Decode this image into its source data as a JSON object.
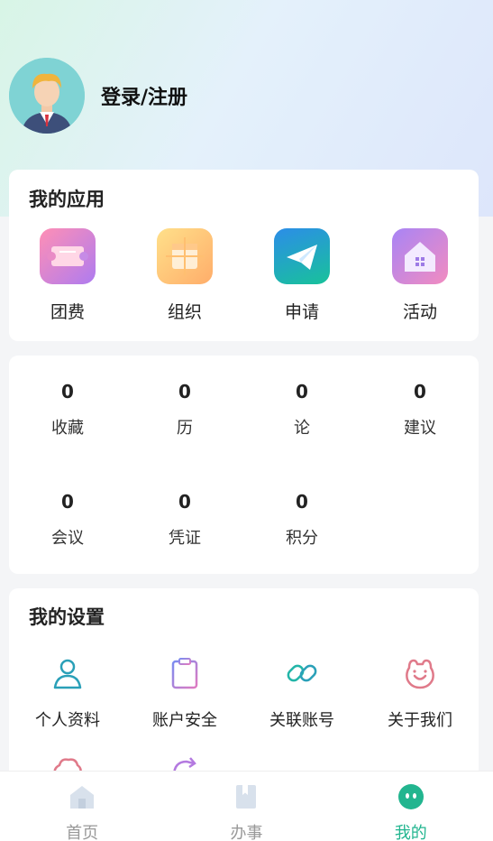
{
  "colors": {
    "accent": "#22b58f",
    "tab_inactive": "#999999",
    "icon_outline": "#2aa0b8"
  },
  "profile": {
    "login_label": "登录/注册",
    "avatar_icon": "user-avatar-icon"
  },
  "apps": {
    "title": "我的应用",
    "items": [
      {
        "label": "团费",
        "icon": "ticket-icon"
      },
      {
        "label": "组织",
        "icon": "organization-icon"
      },
      {
        "label": "申请",
        "icon": "paper-plane-icon"
      },
      {
        "label": "活动",
        "icon": "house-icon"
      }
    ]
  },
  "stats": {
    "items": [
      {
        "value": "0",
        "label": "收藏"
      },
      {
        "value": "0",
        "label": "历"
      },
      {
        "value": "0",
        "label": "论"
      },
      {
        "value": "0",
        "label": "建议"
      },
      {
        "value": "0",
        "label": "会议"
      },
      {
        "value": "0",
        "label": "凭证"
      },
      {
        "value": "0",
        "label": "积分"
      }
    ]
  },
  "settings": {
    "title": "我的设置",
    "items": [
      {
        "label": "个人资料",
        "icon": "person-icon"
      },
      {
        "label": "账户安全",
        "icon": "clipboard-icon"
      },
      {
        "label": "关联账号",
        "icon": "link-icon"
      },
      {
        "label": "关于我们",
        "icon": "smiley-icon"
      }
    ]
  },
  "tabbar": {
    "items": [
      {
        "label": "首页",
        "icon": "home-icon"
      },
      {
        "label": "办事",
        "icon": "bookmark-icon"
      },
      {
        "label": "我的",
        "icon": "profile-face-icon"
      }
    ]
  }
}
